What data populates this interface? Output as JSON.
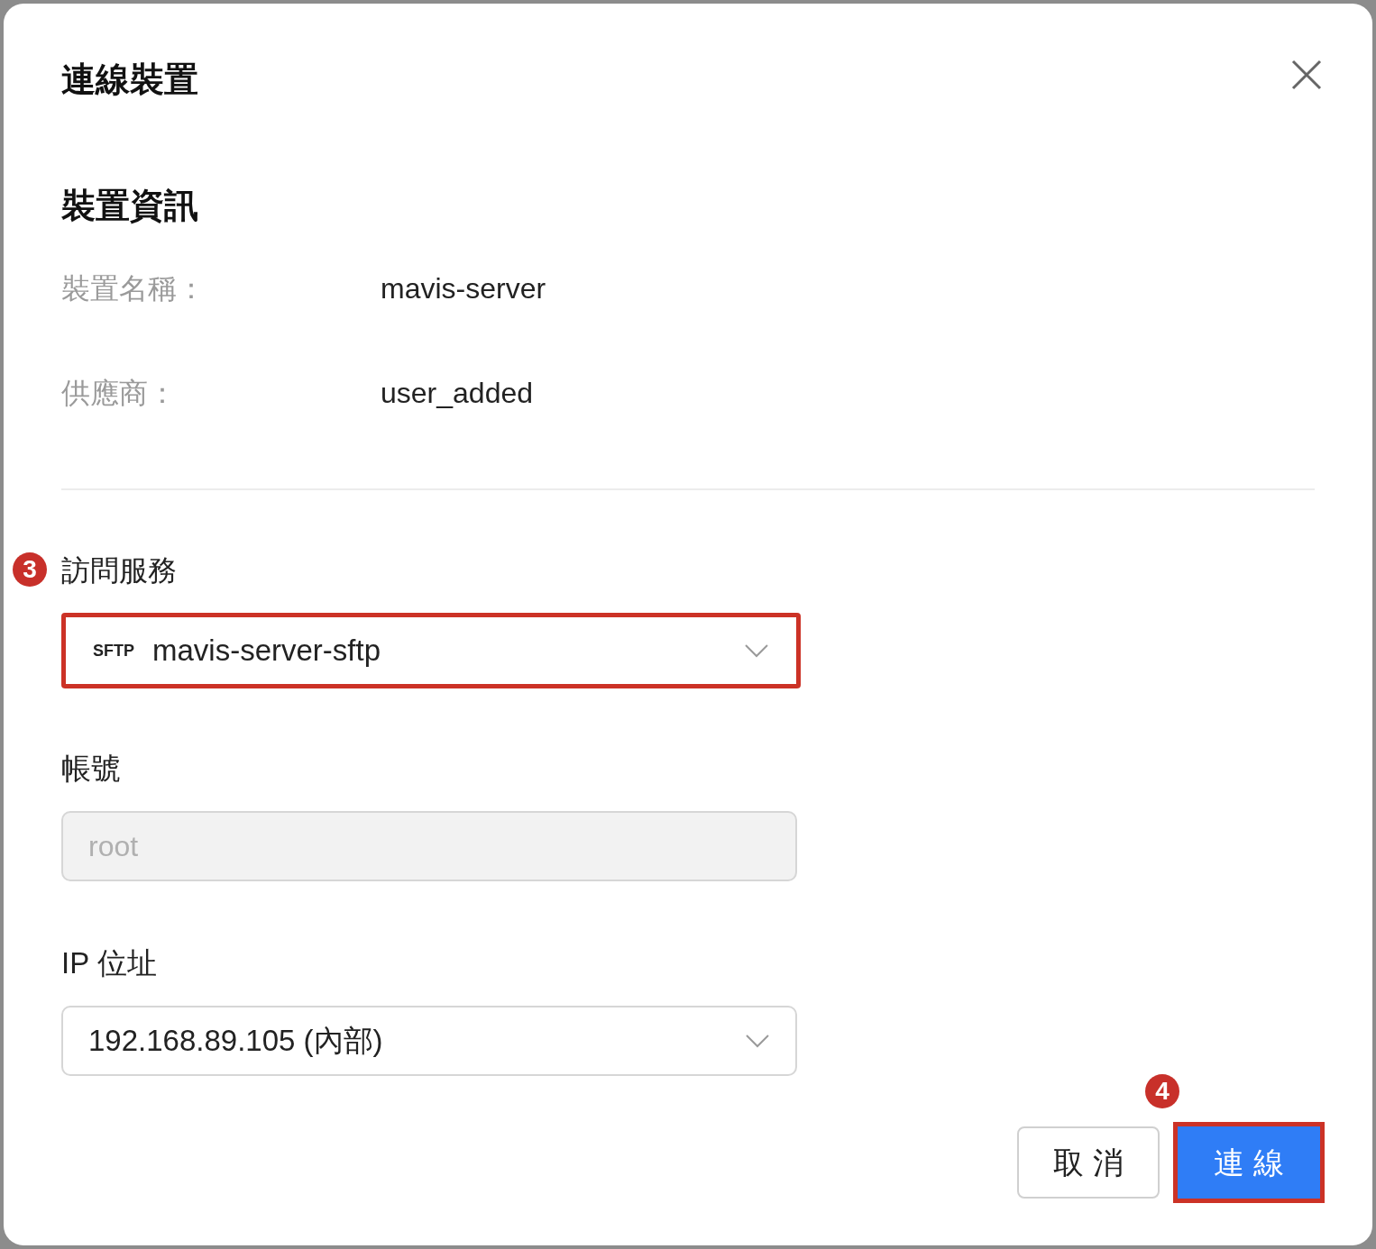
{
  "dialog": {
    "title": "連線裝置"
  },
  "device_info": {
    "heading": "裝置資訊",
    "fields": [
      {
        "label": "裝置名稱：",
        "value": "mavis-server"
      },
      {
        "label": "供應商：",
        "value": "user_added"
      }
    ]
  },
  "service": {
    "label": "訪問服務",
    "marker": "3",
    "badge": "SFTP",
    "value": "mavis-server-sftp",
    "highlighted": true
  },
  "account": {
    "label": "帳號",
    "value": "root",
    "disabled": true
  },
  "ip": {
    "label": "IP 位址",
    "value": "192.168.89.105 (內部)"
  },
  "buttons": [
    {
      "label": "取 消",
      "kind": "secondary",
      "highlighted": false
    },
    {
      "label": "連 線",
      "kind": "primary",
      "marker": "4",
      "highlighted": true
    }
  ]
}
